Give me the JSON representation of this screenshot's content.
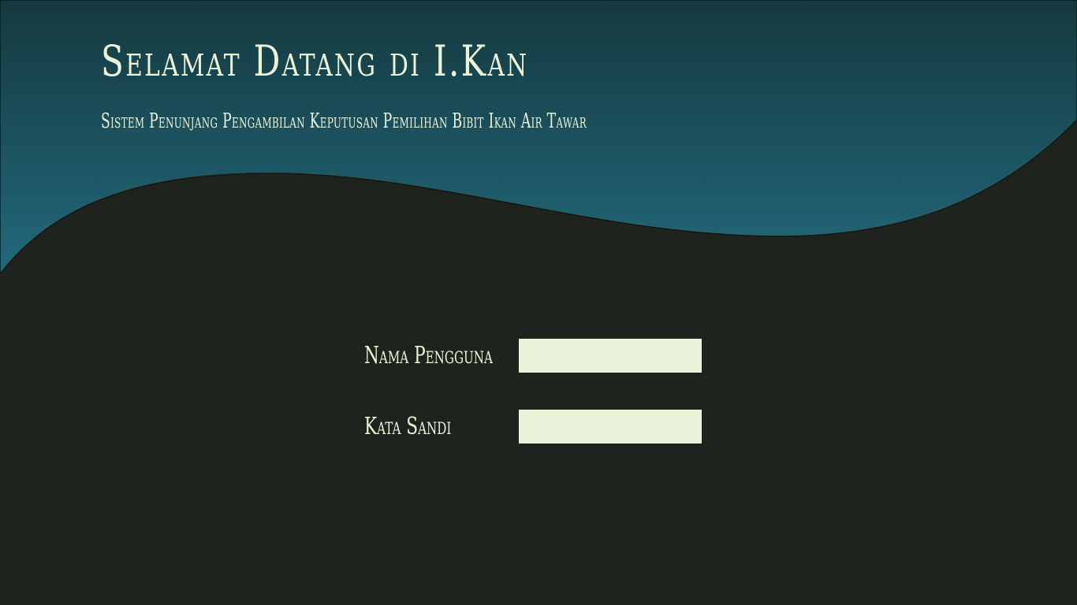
{
  "header": {
    "title": "Selamat Datang di I.Kan",
    "subtitle": "Sistem Penunjang Pengambilan Keputusan Pemilihan Bibit Ikan Air Tawar"
  },
  "login_form": {
    "username_label": "Nama Pengguna",
    "username_value": "",
    "password_label": "Kata Sandi",
    "password_value": ""
  },
  "colors": {
    "header_gradient_top": "#15393f",
    "header_gradient_bottom": "#22697c",
    "body_background": "#1f231e",
    "text": "#ecf2d8",
    "input_background": "#ebf3da"
  }
}
